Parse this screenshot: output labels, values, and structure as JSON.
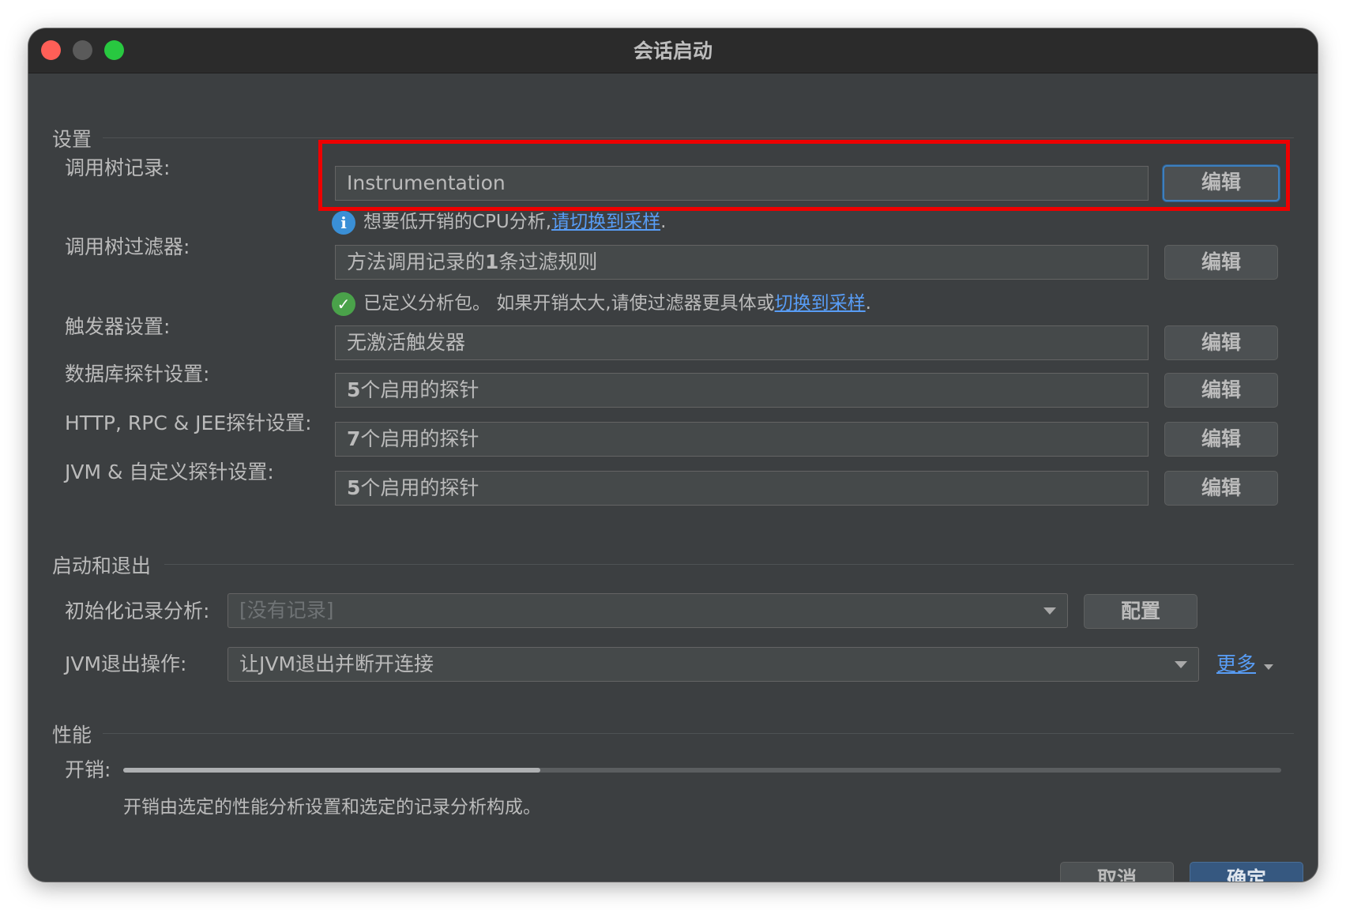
{
  "window": {
    "title": "会话启动"
  },
  "settings": {
    "section_title": "设置",
    "call_tree_recording": {
      "label": "调用树记录:",
      "value": "Instrumentation",
      "button": "编辑"
    },
    "info_hint": {
      "text": "想要低开销的CPU分析,",
      "link": "请切换到采样",
      "suffix": "."
    },
    "call_tree_filter": {
      "label": "调用树过滤器:",
      "value_prefix": "方法调用记录的",
      "value_bold": "1",
      "value_suffix": "条过滤规则",
      "button": "编辑"
    },
    "ok_hint": {
      "text": "已定义分析包。 如果开销太大,请使过滤器更具体或",
      "link": "切换到采样",
      "suffix": "."
    },
    "trigger_settings": {
      "label": "触发器设置:",
      "value": "无激活触发器",
      "button": "编辑"
    },
    "db_probe_settings": {
      "label": "数据库探针设置:",
      "value_bold": "5",
      "value_suffix": "个启用的探针",
      "button": "编辑"
    },
    "http_probe_settings": {
      "label": "HTTP, RPC & JEE探针设置:",
      "value_bold": "7",
      "value_suffix": "个启用的探针",
      "button": "编辑"
    },
    "jvm_probe_settings": {
      "label": "JVM & 自定义探针设置:",
      "value_bold": "5",
      "value_suffix": "个启用的探针",
      "button": "编辑"
    }
  },
  "startup_exit": {
    "section_title": "启动和退出",
    "initial_recording": {
      "label": "初始化记录分析:",
      "value": "[没有记录]",
      "button": "配置"
    },
    "jvm_exit": {
      "label": "JVM退出操作:",
      "value": "让JVM退出并断开连接",
      "more": "更多"
    }
  },
  "performance": {
    "section_title": "性能",
    "overhead_label": "开销:",
    "overhead_fraction": 0.36,
    "description": "开销由选定的性能分析设置和选定的记录分析构成。"
  },
  "footer": {
    "cancel": "取消",
    "ok": "确定"
  },
  "colors": {
    "accent": "#589df6",
    "highlight": "#ee0000",
    "primary_button": "#365880"
  }
}
